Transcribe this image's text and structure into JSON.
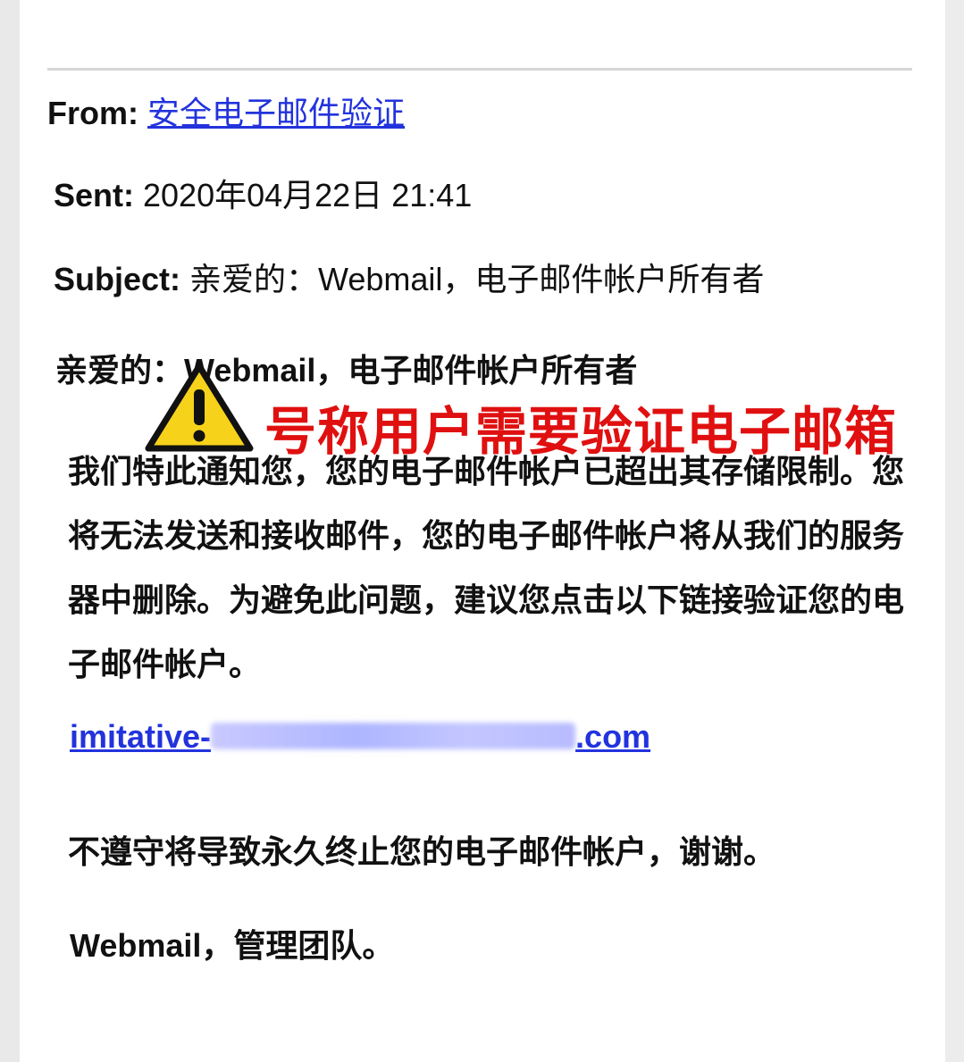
{
  "email": {
    "from_label": "From:",
    "from_value": "安全电子邮件验证",
    "sent_label": "Sent:",
    "sent_value": "2020年04月22日 21:41",
    "subject_label": "Subject:",
    "subject_value": "亲爱的：Webmail，电子邮件帐户所有者",
    "greeting": "亲爱的：Webmail，电子邮件帐户所有者",
    "body": "我们特此通知您，您的电子邮件帐户已超出其存储限制。您将无法发送和接收邮件，您的电子邮件帐户将从我们的服务器中删除。为避免此问题，建议您点击以下链接验证您的电子邮件帐户。",
    "link_prefix": "imitative-",
    "link_suffix": ".com",
    "closing": "不遵守将导致永久终止您的电子邮件帐户，谢谢。",
    "signature": "Webmail，管理团队。"
  },
  "annotation": {
    "warning_text": "号称用户需要验证电子邮箱",
    "warning_icon": "warning-triangle-icon",
    "warning_color": "#e01010"
  },
  "colors": {
    "link": "#2233dd",
    "icon_fill": "#f7d21b"
  }
}
